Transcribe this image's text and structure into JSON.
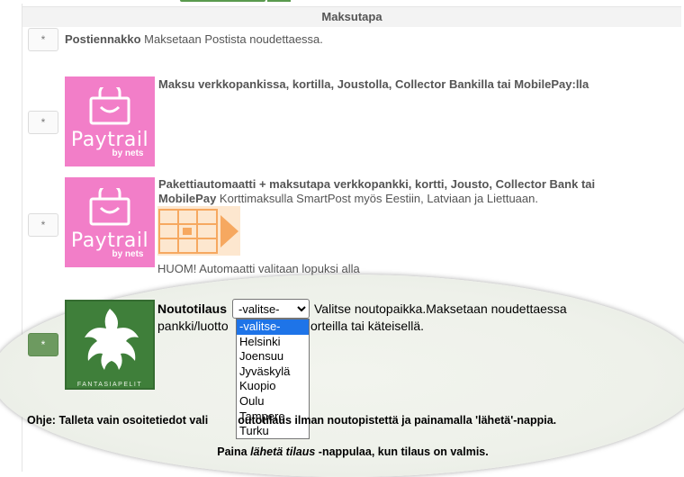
{
  "header": {
    "title": "Maksutapa"
  },
  "options": [
    {
      "button": "*",
      "name": "Postiennakko",
      "description": "Maksetaan Postista noudettaessa."
    },
    {
      "button": "*",
      "name": "Maksu verkkopankissa, kortilla, Joustolla, Collector Bankilla tai MobilePay:lla",
      "logo_brand": "Paytrail",
      "logo_sub": "by nets"
    },
    {
      "button": "*",
      "name_line1": "Pakettiautomaatti + maksutapa verkkopankki, kortti, Jousto, Collector Bank tai",
      "name_line2": "MobilePay",
      "description": "Korttimaksulla SmartPost myös Eestiin, Latviaan ja Liettuaan.",
      "note": "HUOM! Automaatti valitaan lopuksi alla",
      "logo_brand": "Paytrail",
      "logo_sub": "by nets"
    },
    {
      "button": "*",
      "name": "Noutotilaus",
      "description_line1": "Valitse noutopaikka.Maksetaan noudettaessa",
      "description_line2_left": "pankki/luotto",
      "description_line2_right": "orteilla tai käteisellä.",
      "logo_text": "FANTASIAPELIT"
    }
  ],
  "pickup_select": {
    "selected": "-valitse-",
    "options": [
      "-valitse-",
      "Helsinki",
      "Joensuu",
      "Jyväskylä",
      "Kuopio",
      "Oulu",
      "Tampere",
      "Turku"
    ]
  },
  "help": {
    "label": "Ohje:",
    "text_a": "Talleta vain osoitetiedot vali",
    "text_b": "outotilaus ilman noutopistettä ja painamalla 'lähetä'-nappia."
  },
  "footer": {
    "pre": "Paina ",
    "em": "lähetä tilaus",
    "post": " -nappulaa, kun tilaus on valmis."
  },
  "colors": {
    "accent_green": "#6d9a60",
    "paytrail_pink": "#f27ec8",
    "select_highlight": "#1e74e8"
  }
}
